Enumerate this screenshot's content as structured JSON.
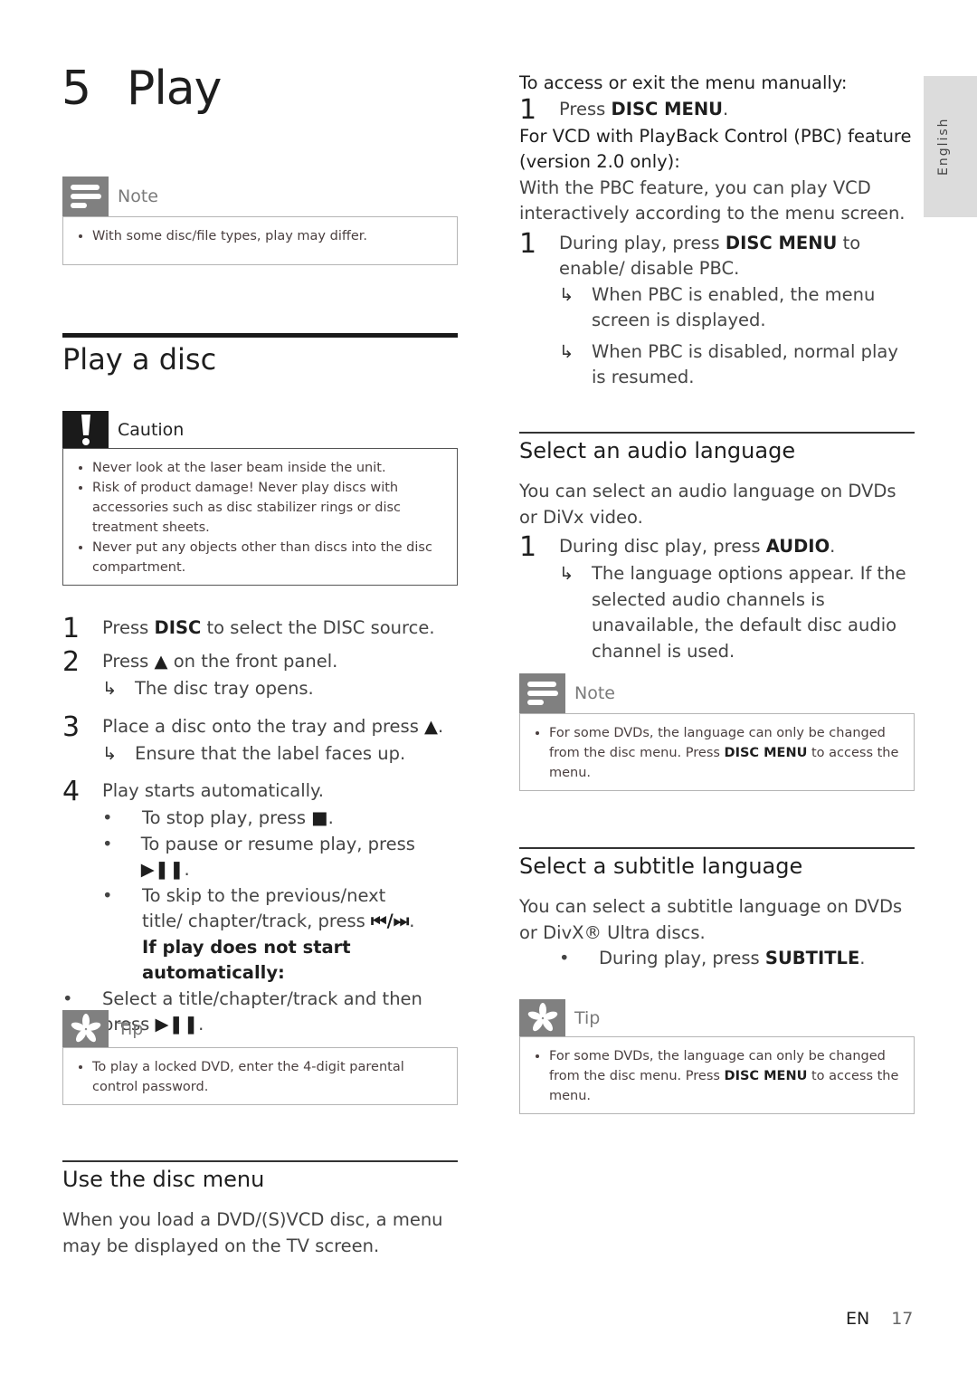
{
  "chapter": {
    "number": "5",
    "title": "Play"
  },
  "side_tab": {
    "label": "English"
  },
  "left": {
    "note1": {
      "label": "Note",
      "icon": "note-lines-icon",
      "items": [
        "With some disc/file types, play may differ."
      ]
    },
    "play_disc": {
      "heading": "Play a disc",
      "caution": {
        "label": "Caution",
        "icon": "exclamation-icon",
        "items": [
          "Never look at the laser beam inside the unit.",
          "Risk of product damage! Never play discs with accessories such as disc stabilizer rings or disc treatment sheets.",
          "Never put any objects other than discs into the disc compartment."
        ]
      },
      "steps": {
        "s1": {
          "num": "1",
          "pre": "Press ",
          "bold": "DISC",
          "post": " to select the DISC source."
        },
        "s2": {
          "num": "2",
          "pre": "Press ",
          "symbol": "▲",
          "post": " on the front panel.",
          "result": "The disc tray opens."
        },
        "s3": {
          "num": "3",
          "pre": "Place a disc onto the tray and press ",
          "symbol": "▲",
          "post": ".",
          "result": "Ensure that the label faces up."
        },
        "s4": {
          "num": "4",
          "text": "Play starts automatically.",
          "bullets": {
            "b1": {
              "text": "To stop play, press ",
              "symbol": "■",
              "post": "."
            },
            "b2": {
              "text": "To pause or resume play, press ",
              "symbol": "▶❚❚",
              "post": "."
            },
            "b3": {
              "text": "To skip to the previous/next title/ chapter/track, press ",
              "symbol": "⏮/⏭",
              "post": "."
            }
          },
          "subhead": "If play does not start automatically:",
          "fallback": {
            "text": "Select a title/chapter/track and then press ",
            "symbol": "▶❚❚",
            "post": "."
          }
        }
      },
      "tip": {
        "label": "Tip",
        "icon": "asterisk-icon",
        "items": [
          "To play a locked DVD, enter the 4-digit parental control password."
        ]
      }
    },
    "disc_menu": {
      "heading": "Use the disc menu",
      "text": "When you load a DVD/(S)VCD disc, a menu may be displayed on the TV screen."
    }
  },
  "right": {
    "manual_head": "To access or exit the menu manually:",
    "manual_step": {
      "num": "1",
      "pre": "Press ",
      "bold": "DISC MENU",
      "post": "."
    },
    "pbc_head": "For VCD with PlayBack Control (PBC) feature (version 2.0 only):",
    "pbc_text": "With the PBC feature, you can play VCD interactively according to the menu screen.",
    "pbc_step": {
      "num": "1",
      "pre": "During play, press ",
      "bold": "DISC MENU",
      "post": " to enable/ disable PBC.",
      "results": [
        "When PBC is enabled, the menu screen is displayed.",
        "When PBC is disabled, normal play is resumed."
      ]
    },
    "audio": {
      "heading": "Select an audio language",
      "text": "You can select an audio language on DVDs or DiVx video.",
      "step": {
        "num": "1",
        "pre": "During disc play, press ",
        "bold": "AUDIO",
        "post": "."
      },
      "result": "The language options appear. If the selected audio channels is unavailable, the default disc audio channel is used.",
      "note": {
        "label": "Note",
        "pre": "For some DVDs, the language can only be changed from the disc menu. Press ",
        "bold": "DISC MENU",
        "post": " to access the menu."
      }
    },
    "subtitle": {
      "heading": "Select a subtitle language",
      "text": "You can select a subtitle language on DVDs or DivX® Ultra discs.",
      "bullet": {
        "pre": "During play, press ",
        "bold": "SUBTITLE",
        "post": "."
      },
      "tip": {
        "label": "Tip",
        "pre": "For some DVDs, the language can only be changed from the disc menu. Press ",
        "bold": "DISC MENU",
        "post": " to access the menu."
      }
    }
  },
  "footer": {
    "lang": "EN",
    "page": "17"
  }
}
